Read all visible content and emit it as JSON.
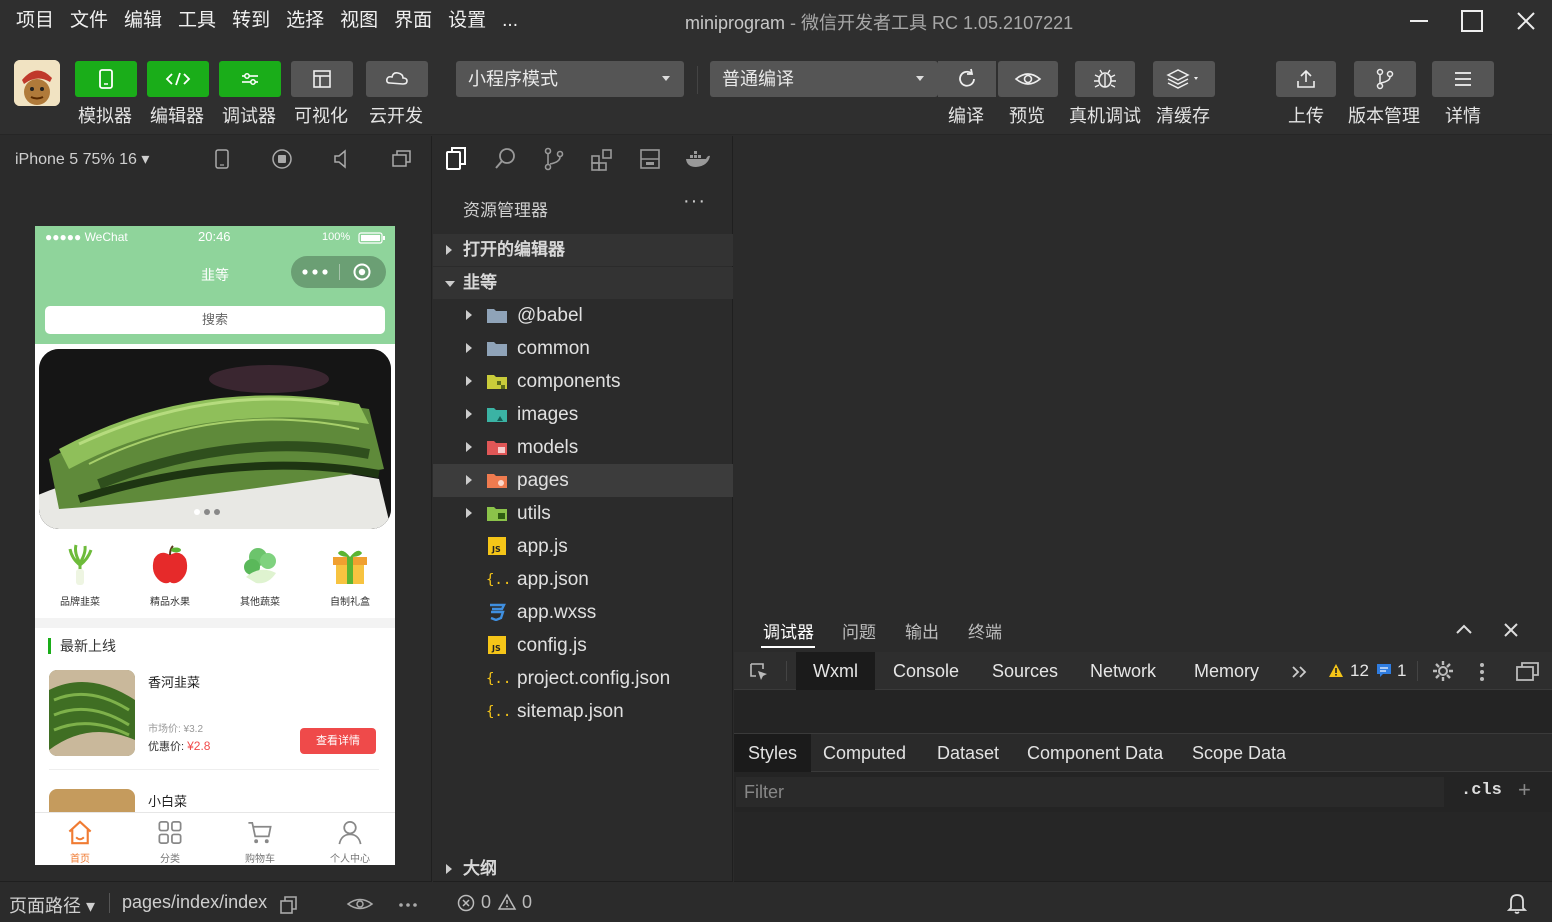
{
  "window": {
    "title_app": "miniprogram",
    "title_rest": " - 微信开发者工具 RC 1.05.2107221"
  },
  "menus": [
    "项目",
    "文件",
    "编辑",
    "工具",
    "转到",
    "选择",
    "视图",
    "界面",
    "设置",
    "..."
  ],
  "toolbar": {
    "left_buttons": [
      {
        "label": "模拟器",
        "icon": "phone-icon"
      },
      {
        "label": "编辑器",
        "icon": "code-icon"
      },
      {
        "label": "调试器",
        "icon": "sliders-icon"
      },
      {
        "label": "可视化",
        "icon": "layout-icon"
      },
      {
        "label": "云开发",
        "icon": "cloud-icon"
      }
    ],
    "mode_select": "小程序模式",
    "compile_select": "普通编译",
    "right_buttons": [
      {
        "label": "编译",
        "icon": "refresh-icon"
      },
      {
        "label": "预览",
        "icon": "eye-icon"
      },
      {
        "label": "真机调试",
        "icon": "bug-icon"
      },
      {
        "label": "清缓存",
        "icon": "layers-icon"
      },
      {
        "label": "上传",
        "icon": "upload-icon"
      },
      {
        "label": "版本管理",
        "icon": "branch-icon"
      },
      {
        "label": "详情",
        "icon": "menu-icon"
      }
    ]
  },
  "simulator": {
    "device": "iPhone 5 75% 16 ▾",
    "statusbar": {
      "carrier": "●●●●● WeChat",
      "time": "20:46",
      "battery": "100%"
    },
    "nav_title": "韭等",
    "search_placeholder": "搜索",
    "categories": [
      "品牌韭菜",
      "精品水果",
      "其他蔬菜",
      "自制礼盒"
    ],
    "section_title": "最新上线",
    "products": [
      {
        "name": "香河韭菜",
        "market_label": "市场价: ¥3.2",
        "sale_label": "优惠价: ",
        "sale_price": "¥2.8",
        "button": "查看详情"
      },
      {
        "name": "小白菜"
      }
    ],
    "tabs": [
      {
        "label": "首页",
        "active": true
      },
      {
        "label": "分类"
      },
      {
        "label": "购物车"
      },
      {
        "label": "个人中心"
      }
    ]
  },
  "explorer": {
    "header": "资源管理器",
    "more": "···",
    "open_editors": "打开的编辑器",
    "project": "韭等",
    "folders": [
      {
        "name": "@babel",
        "color": "#8fa3b8"
      },
      {
        "name": "common",
        "color": "#8fa3b8"
      },
      {
        "name": "components",
        "color": "#c9cc3a"
      },
      {
        "name": "images",
        "color": "#3bb3a4"
      },
      {
        "name": "models",
        "color": "#e05757"
      },
      {
        "name": "pages",
        "color": "#ef7b4f"
      },
      {
        "name": "utils",
        "color": "#8bc34a"
      }
    ],
    "files": [
      {
        "name": "app.js",
        "type": "js"
      },
      {
        "name": "app.json",
        "type": "json"
      },
      {
        "name": "app.wxss",
        "type": "css"
      },
      {
        "name": "config.js",
        "type": "js"
      },
      {
        "name": "project.config.json",
        "type": "json"
      },
      {
        "name": "sitemap.json",
        "type": "json"
      }
    ],
    "outline": "大纲"
  },
  "debugger": {
    "panel_tabs": [
      "调试器",
      "问题",
      "输出",
      "终端"
    ],
    "dev_tabs": [
      "Wxml",
      "Console",
      "Sources",
      "Network",
      "Memory"
    ],
    "warnings": "12",
    "infos": "1",
    "style_tabs": [
      "Styles",
      "Computed",
      "Dataset",
      "Component Data",
      "Scope Data"
    ],
    "filter_placeholder": "Filter",
    "cls": ".cls",
    "plus": "+"
  },
  "status": {
    "page_path_label": "页面路径 ▾",
    "page_path": "pages/index/index",
    "errors": "0",
    "warnings": "0"
  },
  "colors": {
    "accent_green": "#1aad19",
    "mint": "#8fd49b",
    "price_red": "#f04b4b",
    "tab_orange": "#f07b32"
  }
}
